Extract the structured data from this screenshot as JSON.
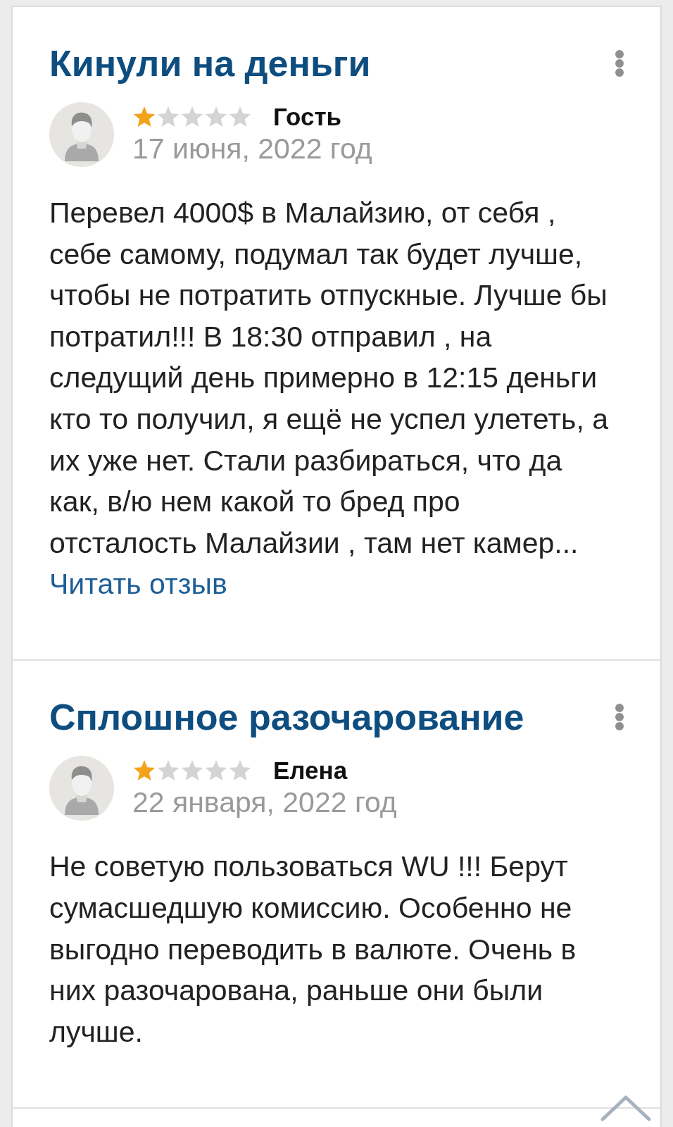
{
  "reviews": [
    {
      "title": "Кинули на деньги",
      "stars": 1,
      "author": "Гость",
      "date": "17 июня, 2022 год",
      "text": "Перевел 4000$ в Малайзию, от себя , себе самому, подумал так будет лучше, чтобы не потратить отпускные. Лучше бы потратил!!! В 18:30 отправил , на следущий день примерно в 12:15 деньги кто то получил, я ещё не успел улететь, а их уже нет. Стали разбираться, что да как, в/ю нем какой то бред про отсталость Малайзии , там нет камер...",
      "read_more": "Читать отзыв"
    },
    {
      "title": "Сплошное разочарование",
      "stars": 1,
      "author": "Елена",
      "date": "22 января, 2022 год",
      "text": "Не советую пользоваться WU !!! Берут сумасшедшую комиссию. Особенно не выгодно переводить в валюте. Очень в них разочарована, раньше они были лучше."
    }
  ]
}
